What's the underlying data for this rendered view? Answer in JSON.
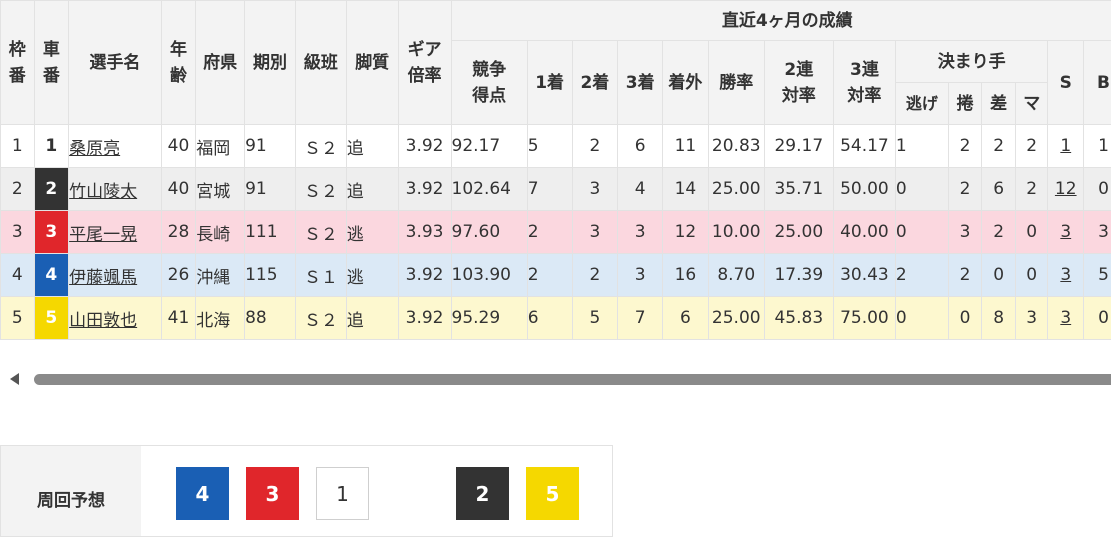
{
  "table": {
    "headers": {
      "waku": "枠番",
      "car": "車番",
      "name": "選手名",
      "age": "年齢",
      "pref": "府県",
      "term": "期別",
      "class": "級班",
      "leg": "脚質",
      "gear": "ギア倍率",
      "recent": "直近4ヶ月の成績",
      "score": "競争得点",
      "first": "1着",
      "second": "2着",
      "third": "3着",
      "out": "着外",
      "win": "勝率",
      "quinella": "2連対率",
      "trio": "3連対率",
      "kimarite": "決まり手",
      "nige": "逃げ",
      "makuri": "捲",
      "sashi": "差",
      "mark": "マ",
      "s": "S",
      "b": "B"
    },
    "rows": [
      {
        "waku": "1",
        "car": "1",
        "name": "桑原亮",
        "age": "40",
        "pref": "福岡",
        "term": "91",
        "class": "Ｓ２",
        "leg": "追",
        "gear": "3.92",
        "score": "92.17",
        "first": "5",
        "second": "2",
        "third": "6",
        "out": "11",
        "win": "20.83",
        "quinella": "29.17",
        "trio": "54.17",
        "nige": "1",
        "makuri": "2",
        "sashi": "2",
        "mark": "2",
        "s": "1",
        "b": "1",
        "car_bg": "#ffffff",
        "car_fg": "#333333"
      },
      {
        "waku": "2",
        "car": "2",
        "name": "竹山陵太",
        "age": "40",
        "pref": "宮城",
        "term": "91",
        "class": "Ｓ２",
        "leg": "追",
        "gear": "3.92",
        "score": "102.64",
        "first": "7",
        "second": "3",
        "third": "4",
        "out": "14",
        "win": "25.00",
        "quinella": "35.71",
        "trio": "50.00",
        "nige": "0",
        "makuri": "2",
        "sashi": "6",
        "mark": "2",
        "s": "12",
        "b": "0",
        "car_bg": "#333333",
        "car_fg": "#ffffff"
      },
      {
        "waku": "3",
        "car": "3",
        "name": "平尾一晃",
        "age": "28",
        "pref": "長崎",
        "term": "111",
        "class": "Ｓ２",
        "leg": "逃",
        "gear": "3.93",
        "score": "97.60",
        "first": "2",
        "second": "3",
        "third": "3",
        "out": "12",
        "win": "10.00",
        "quinella": "25.00",
        "trio": "40.00",
        "nige": "0",
        "makuri": "3",
        "sashi": "2",
        "mark": "0",
        "s": "3",
        "b": "3",
        "car_bg": "#e0262b",
        "car_fg": "#ffffff"
      },
      {
        "waku": "4",
        "car": "4",
        "name": "伊藤颯馬",
        "age": "26",
        "pref": "沖縄",
        "term": "115",
        "class": "Ｓ１",
        "leg": "逃",
        "gear": "3.92",
        "score": "103.90",
        "first": "2",
        "second": "2",
        "third": "3",
        "out": "16",
        "win": "8.70",
        "quinella": "17.39",
        "trio": "30.43",
        "nige": "2",
        "makuri": "2",
        "sashi": "0",
        "mark": "0",
        "s": "3",
        "b": "5",
        "car_bg": "#1a5fb4",
        "car_fg": "#ffffff"
      },
      {
        "waku": "5",
        "car": "5",
        "name": "山田敦也",
        "age": "41",
        "pref": "北海",
        "term": "88",
        "class": "Ｓ２",
        "leg": "追",
        "gear": "3.92",
        "score": "95.29",
        "first": "6",
        "second": "5",
        "third": "7",
        "out": "6",
        "win": "25.00",
        "quinella": "45.83",
        "trio": "75.00",
        "nige": "0",
        "makuri": "0",
        "sashi": "8",
        "mark": "3",
        "s": "3",
        "b": "0",
        "car_bg": "#f5d800",
        "car_fg": "#ffffff"
      }
    ]
  },
  "forecast": {
    "label": "周回予想",
    "chips": [
      {
        "num": "4",
        "bg": "#1a5fb4",
        "fg": "#ffffff"
      },
      {
        "num": "3",
        "bg": "#e0262b",
        "fg": "#ffffff"
      },
      {
        "num": "1",
        "bg": "#ffffff",
        "fg": "#333333"
      },
      {
        "num": "2",
        "bg": "#333333",
        "fg": "#ffffff"
      },
      {
        "num": "5",
        "bg": "#f5d800",
        "fg": "#ffffff"
      }
    ]
  }
}
